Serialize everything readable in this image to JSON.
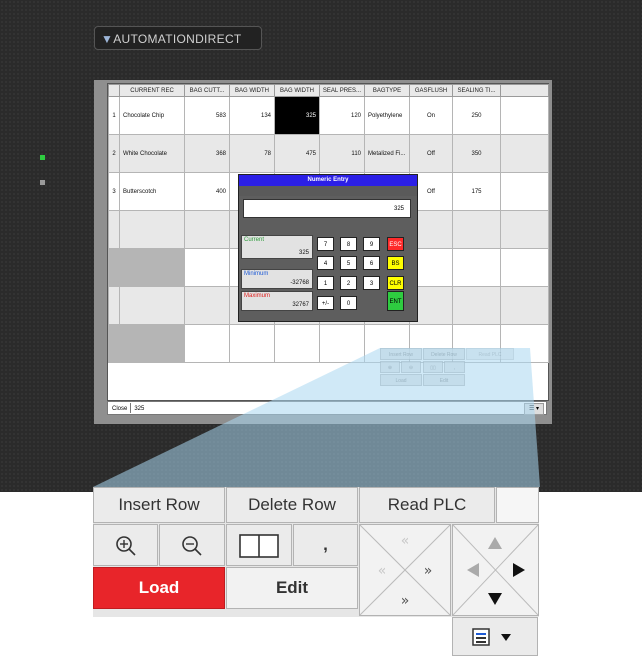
{
  "logo": {
    "brand": "AUTOMATIONDIRECT",
    "mark": "▼"
  },
  "table": {
    "headers": [
      "",
      "CURRENT REC",
      "BAG CUTT...",
      "BAG WIDTH",
      "BAG WIDTH",
      "SEAL PRES...",
      "BAGTYPE",
      "GASFLUSH",
      "SEALING TI...",
      ""
    ],
    "rows": [
      [
        "1",
        "Chocolate Chip",
        "583",
        "134",
        "325",
        "120",
        "Polyethylene",
        "On",
        "250",
        ""
      ],
      [
        "2",
        "White Chocolate",
        "368",
        "78",
        "475",
        "110",
        "Metalized Fi...",
        "Off",
        "350",
        ""
      ],
      [
        "3",
        "Butterscotch",
        "400",
        "",
        "",
        "",
        "",
        "Off",
        "175",
        ""
      ],
      [
        "",
        "",
        "",
        "",
        "",
        "",
        "",
        "",
        "",
        ""
      ],
      [
        "",
        "",
        "",
        "",
        "",
        "",
        "",
        "",
        "",
        ""
      ],
      [
        "",
        "",
        "",
        "",
        "",
        "",
        "",
        "",
        "",
        ""
      ],
      [
        "",
        "",
        "",
        "",
        "",
        "",
        "",
        "",
        "",
        ""
      ],
      [
        "",
        "",
        "",
        "",
        "",
        "",
        "",
        "",
        "",
        ""
      ]
    ]
  },
  "status": {
    "close_label": "Close",
    "value": "325"
  },
  "numeric_entry": {
    "title": "Numeric Entry",
    "entry_value": "325",
    "current_label": "Current",
    "current_value": "325",
    "minimum_label": "Minimum",
    "minimum_value": "-32768",
    "maximum_label": "Maximum",
    "maximum_value": "32767",
    "keys": {
      "k7": "7",
      "k8": "8",
      "k9": "9",
      "esc": "ESC",
      "k4": "4",
      "k5": "5",
      "k6": "6",
      "bs": "BS",
      "k1": "1",
      "k2": "2",
      "k3": "3",
      "clr": "CLR",
      "sign": "+/-",
      "k0": "0",
      "ent": "ENT"
    }
  },
  "edit_panel": {
    "insert_row": "Insert Row",
    "delete_row": "Delete Row",
    "read_plc": "Read PLC",
    "comma": ",",
    "load": "Load",
    "edit": "Edit"
  },
  "colors": {
    "title_bar": "#2b1fe6",
    "esc_key": "#ff2a2a",
    "bs_clr_key": "#ffff00",
    "ent_key": "#2ecc40",
    "load_button": "#e8252a",
    "current_label": "#2e9c3c",
    "minimum_label": "#1e5bd6",
    "maximum_label": "#e0201e"
  }
}
